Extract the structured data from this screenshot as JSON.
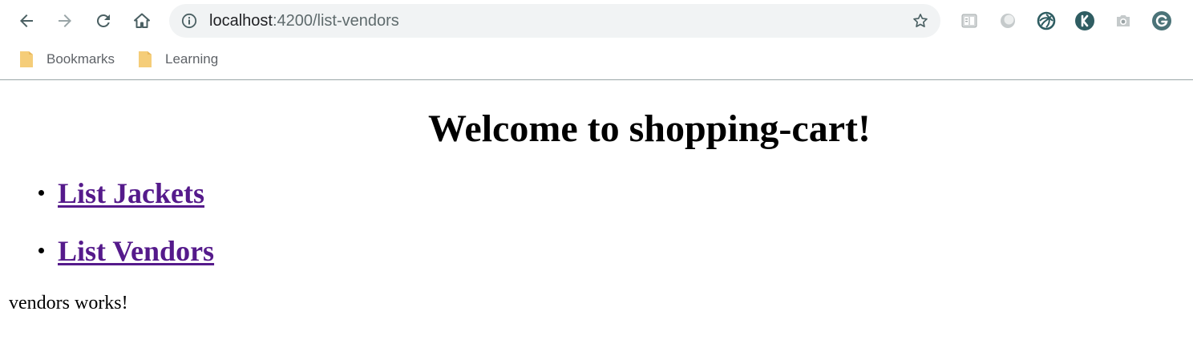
{
  "browser": {
    "url_host": "localhost",
    "url_rest": ":4200/list-vendors",
    "nav_icons": [
      "back-arrow-icon",
      "forward-arrow-icon",
      "reload-icon",
      "home-icon"
    ],
    "extensions": [
      "reader-extension-icon",
      "circle-extension-icon",
      "swirl-extension-icon",
      "k-extension-icon",
      "camera-extension-icon",
      "g-profile-icon"
    ],
    "profile_initial": "G",
    "accent": "#4b7378"
  },
  "bookmarks": {
    "items": [
      {
        "label": "Bookmarks",
        "icon": "folder-icon"
      },
      {
        "label": "Learning",
        "icon": "folder-icon"
      }
    ],
    "folder_color": "#f5cd79"
  },
  "page": {
    "title": "Welcome to shopping-cart!",
    "links": [
      {
        "label": "List Jackets"
      },
      {
        "label": "List Vendors"
      }
    ],
    "link_color": "#551a8b",
    "body_text": "vendors works!"
  }
}
